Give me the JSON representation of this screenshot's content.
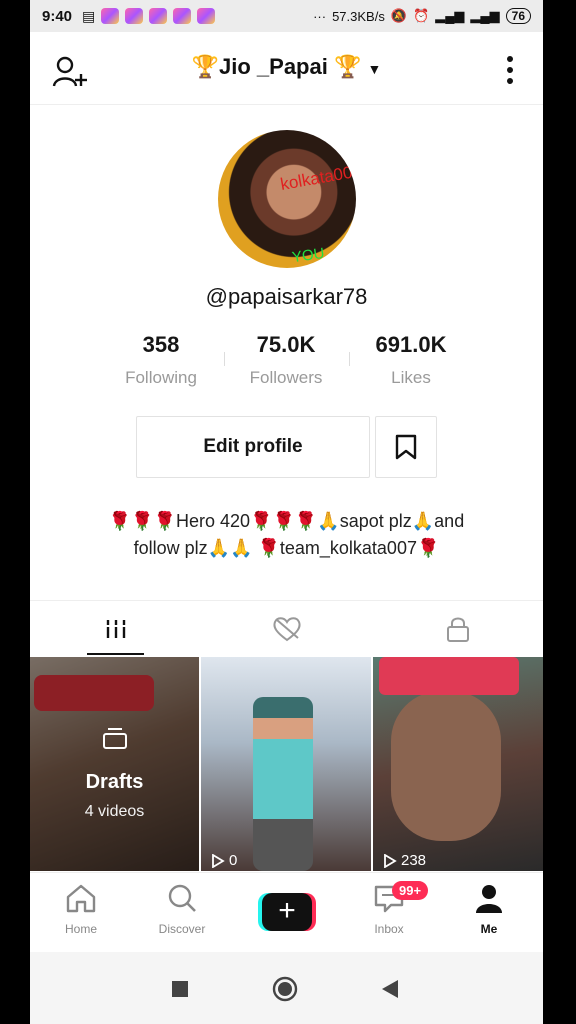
{
  "status_bar": {
    "time": "9:40",
    "speed": "57.3KB/s",
    "battery": "76"
  },
  "header": {
    "title": "Jio _Papai",
    "title_emoji_left": "🏆",
    "title_emoji_right": "🏆"
  },
  "profile": {
    "username": "@papaisarkar78",
    "avatar_watermark_1": "kolkata007",
    "avatar_watermark_2": "YOU"
  },
  "stats": [
    {
      "value": "358",
      "label": "Following"
    },
    {
      "value": "75.0K",
      "label": "Followers"
    },
    {
      "value": "691.0K",
      "label": "Likes"
    }
  ],
  "actions": {
    "edit_profile_label": "Edit profile"
  },
  "bio": {
    "line1": "🌹🌹🌹Hero 420🌹🌹🌹🙏sapot plz🙏and",
    "line2": "follow plz🙏🙏 🌹team_kolkata007🌹"
  },
  "tabs": [
    {
      "icon": "grid-icon"
    },
    {
      "icon": "liked-heart-hidden-icon"
    },
    {
      "icon": "lock-icon"
    }
  ],
  "videos": {
    "drafts": {
      "title": "Drafts",
      "count": "4 videos"
    },
    "items": [
      {
        "plays": "0"
      },
      {
        "plays": "238"
      }
    ]
  },
  "bottom_nav": {
    "items": [
      {
        "label": "Home",
        "icon": "home-icon"
      },
      {
        "label": "Discover",
        "icon": "search-icon"
      },
      {
        "label": "",
        "icon": "plus-icon"
      },
      {
        "label": "Inbox",
        "icon": "inbox-icon",
        "badge": "99+"
      },
      {
        "label": "Me",
        "icon": "person-icon"
      }
    ]
  }
}
